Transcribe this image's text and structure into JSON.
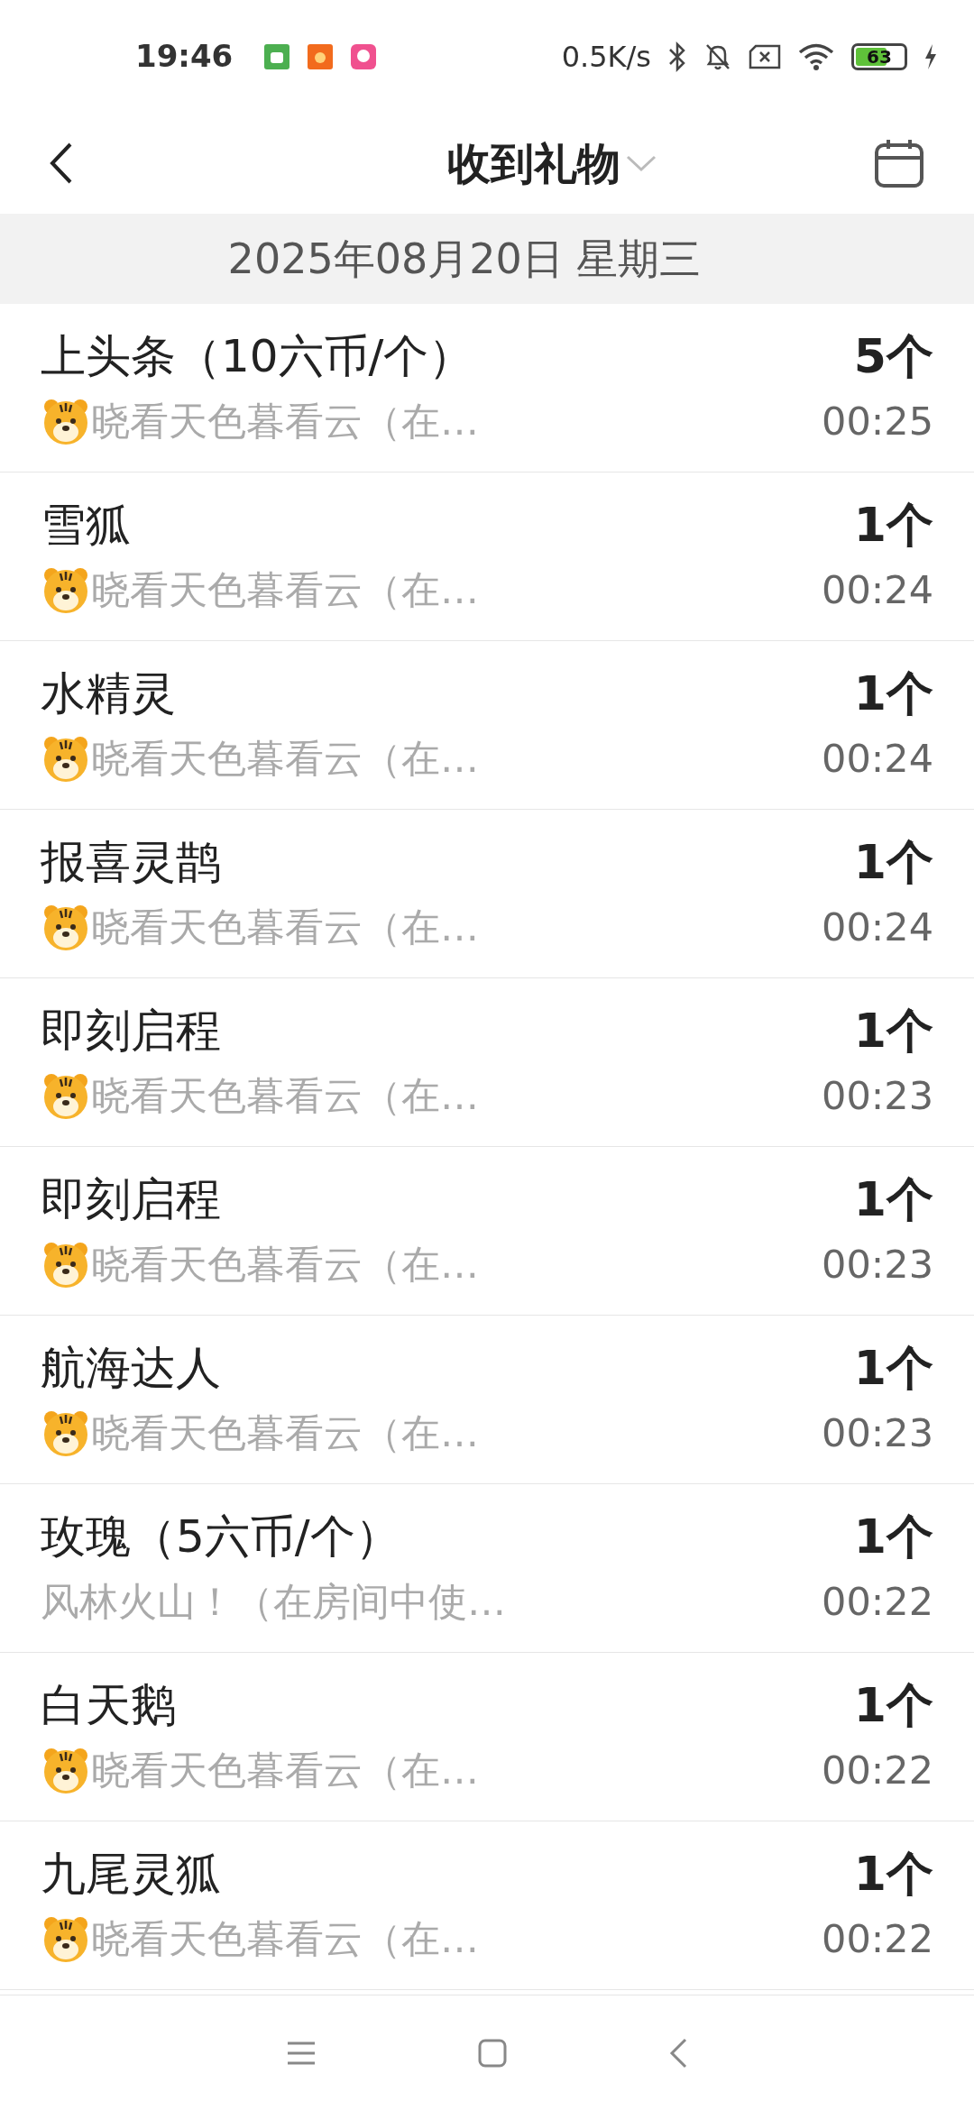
{
  "status_bar": {
    "time": "19:46",
    "speed": "0.5K/s",
    "battery": "63"
  },
  "header": {
    "title": "收到礼物"
  },
  "date_header": "2025年08月20日 星期三",
  "gifts": [
    {
      "name": "上头条（10六币/个）",
      "sender": "晓看天色暮看云（在…",
      "sender_icon": true,
      "count": "5个",
      "time": "00:25"
    },
    {
      "name": "雪狐",
      "sender": "晓看天色暮看云（在…",
      "sender_icon": true,
      "count": "1个",
      "time": "00:24"
    },
    {
      "name": "水精灵",
      "sender": "晓看天色暮看云（在…",
      "sender_icon": true,
      "count": "1个",
      "time": "00:24"
    },
    {
      "name": "报喜灵鹊",
      "sender": "晓看天色暮看云（在…",
      "sender_icon": true,
      "count": "1个",
      "time": "00:24"
    },
    {
      "name": "即刻启程",
      "sender": "晓看天色暮看云（在…",
      "sender_icon": true,
      "count": "1个",
      "time": "00:23"
    },
    {
      "name": "即刻启程",
      "sender": "晓看天色暮看云（在…",
      "sender_icon": true,
      "count": "1个",
      "time": "00:23"
    },
    {
      "name": "航海达人",
      "sender": "晓看天色暮看云（在…",
      "sender_icon": true,
      "count": "1个",
      "time": "00:23"
    },
    {
      "name": "玫瑰（5六币/个）",
      "sender": "风林火山！（在房间中使…",
      "sender_icon": false,
      "count": "1个",
      "time": "00:22"
    },
    {
      "name": "白天鹅",
      "sender": "晓看天色暮看云（在…",
      "sender_icon": true,
      "count": "1个",
      "time": "00:22"
    },
    {
      "name": "九尾灵狐",
      "sender": "晓看天色暮看云（在…",
      "sender_icon": true,
      "count": "1个",
      "time": "00:22"
    }
  ]
}
